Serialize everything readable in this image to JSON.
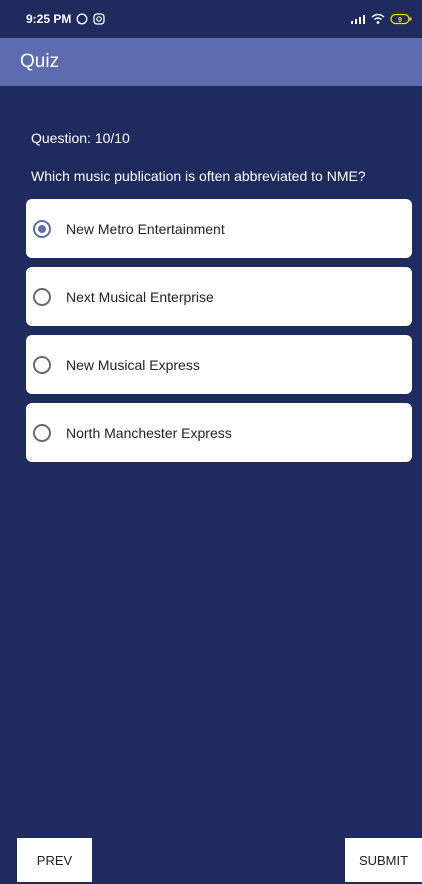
{
  "status_bar": {
    "time": "9:25 PM",
    "left_icons": [
      "whatsapp-icon",
      "instagram-icon"
    ],
    "right_icons": [
      "signal-icon",
      "wifi-icon",
      "battery-icon"
    ],
    "battery_level": "9"
  },
  "app_bar": {
    "title": "Quiz"
  },
  "question": {
    "number_text": "Question: 10/10",
    "text": "Which music publication is often abbreviated to NME?"
  },
  "options": [
    {
      "label": "New Metro Entertainment",
      "selected": true
    },
    {
      "label": "Next Musical Enterprise",
      "selected": false
    },
    {
      "label": "New Musical Express",
      "selected": false
    },
    {
      "label": "North Manchester Express",
      "selected": false
    }
  ],
  "buttons": {
    "prev_label": "PREV",
    "submit_label": "SUBMIT"
  },
  "colors": {
    "background": "#1f2a5e",
    "app_bar": "#5d6cae",
    "accent": "#5d6cae"
  }
}
